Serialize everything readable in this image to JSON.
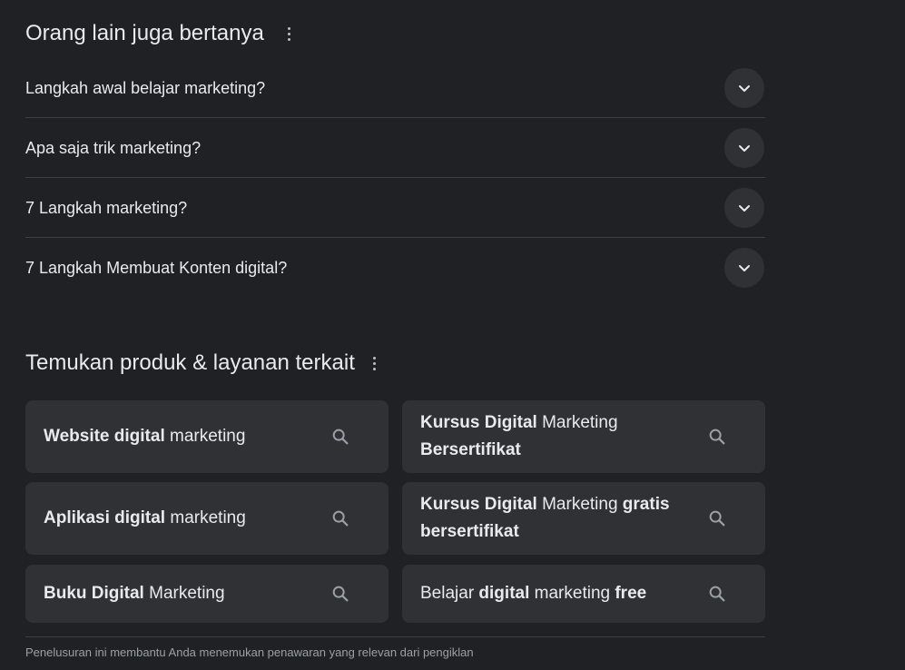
{
  "people_also_ask": {
    "title": "Orang lain juga bertanya",
    "questions": [
      "Langkah awal belajar marketing?",
      "Apa saja trik marketing?",
      "7 Langkah marketing?",
      "7 Langkah Membuat Konten digital?"
    ]
  },
  "related": {
    "title": "Temukan produk & layanan terkait",
    "items": [
      {
        "segments": [
          {
            "text": "Website digital",
            "bold": true
          },
          {
            "text": " marketing",
            "bold": false
          }
        ]
      },
      {
        "segments": [
          {
            "text": "Kursus Digital",
            "bold": true
          },
          {
            "text": " Marketing ",
            "bold": false
          },
          {
            "text": "Bersertifikat",
            "bold": true
          }
        ]
      },
      {
        "segments": [
          {
            "text": "Aplikasi digital",
            "bold": true
          },
          {
            "text": " marketing",
            "bold": false
          }
        ]
      },
      {
        "segments": [
          {
            "text": "Kursus Digital",
            "bold": true
          },
          {
            "text": " Marketing ",
            "bold": false
          },
          {
            "text": "gratis bersertifikat",
            "bold": true
          }
        ]
      },
      {
        "segments": [
          {
            "text": "Buku Digital",
            "bold": true
          },
          {
            "text": " Marketing",
            "bold": false
          }
        ]
      },
      {
        "segments": [
          {
            "text": "Belajar ",
            "bold": false
          },
          {
            "text": "digital",
            "bold": true
          },
          {
            "text": " marketing ",
            "bold": false
          },
          {
            "text": "free",
            "bold": true
          }
        ]
      }
    ]
  },
  "footnote": "Penelusuran ini membantu Anda menemukan penawaran yang relevan dari pengiklan",
  "icons": {
    "more": "more-vert-icon",
    "expand": "chevron-down-icon",
    "search": "search-icon"
  },
  "colors": {
    "background": "#202124",
    "surface": "#303134",
    "text": "#e8eaed",
    "muted": "#9aa0a6",
    "divider": "#3c4043"
  }
}
